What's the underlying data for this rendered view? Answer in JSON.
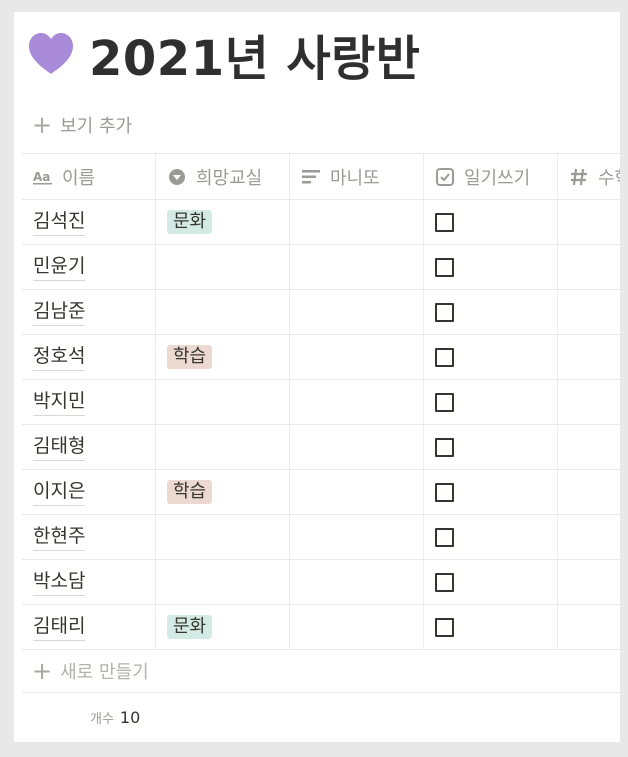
{
  "page": {
    "emoji_name": "purple-heart-icon",
    "title": "2021년 사랑반"
  },
  "view": {
    "add_view_label": "보기 추가"
  },
  "table": {
    "columns": [
      {
        "label": "이름",
        "icon": "text-property-icon"
      },
      {
        "label": "희망교실",
        "icon": "select-property-icon"
      },
      {
        "label": "마니또",
        "icon": "text-lines-icon"
      },
      {
        "label": "일기쓰기",
        "icon": "checkbox-property-icon"
      },
      {
        "label": "수학",
        "icon": "number-property-icon"
      }
    ],
    "rows": [
      {
        "name": "김석진",
        "tag": "문화",
        "manito": "",
        "diary": false
      },
      {
        "name": "민윤기",
        "tag": "",
        "manito": "",
        "diary": false
      },
      {
        "name": "김남준",
        "tag": "",
        "manito": "",
        "diary": false
      },
      {
        "name": "정호석",
        "tag": "학습",
        "manito": "",
        "diary": false
      },
      {
        "name": "박지민",
        "tag": "",
        "manito": "",
        "diary": false
      },
      {
        "name": "김태형",
        "tag": "",
        "manito": "",
        "diary": false
      },
      {
        "name": "이지은",
        "tag": "학습",
        "manito": "",
        "diary": false
      },
      {
        "name": "한현주",
        "tag": "",
        "manito": "",
        "diary": false
      },
      {
        "name": "박소담",
        "tag": "",
        "manito": "",
        "diary": false
      },
      {
        "name": "김태리",
        "tag": "문화",
        "manito": "",
        "diary": false
      }
    ],
    "new_row_label": "새로 만들기",
    "count_label": "개수",
    "count_value": "10"
  },
  "colors": {
    "heart": "#a98ad9",
    "tag_culture_bg": "#d3ebe4",
    "tag_study_bg": "#ecd9d2",
    "text": "#37352f",
    "muted": "#9b9a97"
  }
}
